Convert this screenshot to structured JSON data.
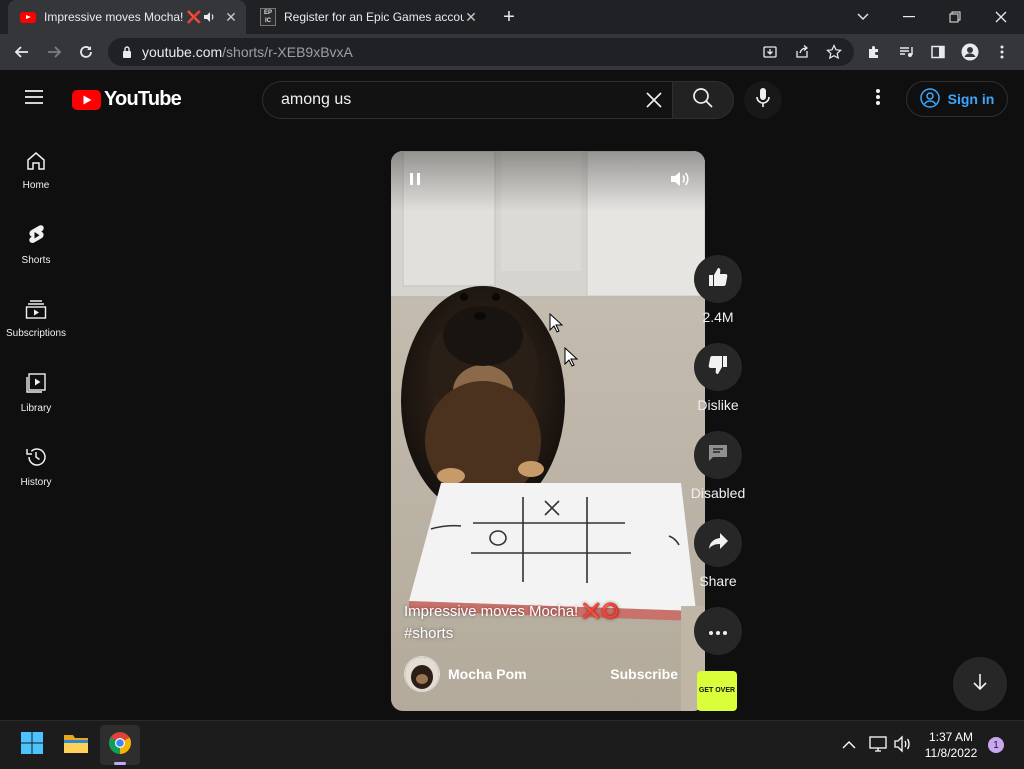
{
  "browser": {
    "tabs": [
      {
        "title": "Impressive moves Mocha! ❌⭕",
        "active": true,
        "icon": "youtube-favicon",
        "audio": "speaker-icon"
      },
      {
        "title": "Register for an Epic Games accou",
        "active": false,
        "icon": "epic-games-favicon"
      }
    ],
    "new_tab": "+",
    "url_domain": "youtube.com",
    "url_path": "/shorts/r-XEB9xBvxA"
  },
  "youtube": {
    "logo_text": "YouTube",
    "search": {
      "value": "among us",
      "placeholder": "Search"
    },
    "sign_in": "Sign in",
    "nav": [
      {
        "label": "Home",
        "icon": "home-icon"
      },
      {
        "label": "Shorts",
        "icon": "shorts-icon"
      },
      {
        "label": "Subscriptions",
        "icon": "subscriptions-icon"
      },
      {
        "label": "Library",
        "icon": "library-icon"
      },
      {
        "label": "History",
        "icon": "history-icon"
      }
    ]
  },
  "short": {
    "title_line1": "Impressive moves Mocha! ❌⭕",
    "title_line2": "#shorts",
    "channel": "Mocha Pom",
    "subscribe": "Subscribe",
    "likes": "2.4M",
    "dislike": "Dislike",
    "comments": "Disabled",
    "share": "Share",
    "sound_thumb_text": "GET OVER"
  },
  "taskbar": {
    "time": "1:37 AM",
    "date": "11/8/2022",
    "notifications": "1"
  },
  "colors": {
    "youtube_red": "#ff0000",
    "link_blue": "#3ea6ff",
    "background": "#0f0f0f"
  }
}
